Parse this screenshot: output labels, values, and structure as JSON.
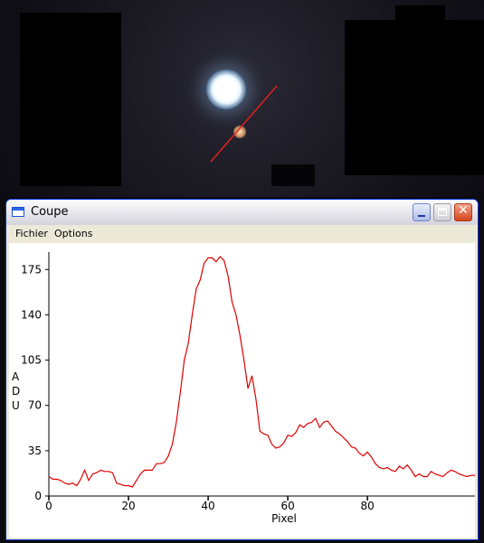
{
  "window": {
    "title": "Coupe",
    "buttons": {
      "minimize_icon": "minimize-icon",
      "maximize_icon": "maximize-icon",
      "close_icon": "close-icon",
      "close_glyph": "✕"
    }
  },
  "menu": {
    "items": [
      {
        "label": "Fichier"
      },
      {
        "label": "Options"
      }
    ]
  },
  "chart_data": {
    "type": "line",
    "xlabel": "Pixel",
    "ylabel": "A\nD\nU",
    "ylabel_letters": [
      "A",
      "D",
      "U"
    ],
    "x_ticks": [
      0,
      20,
      40,
      60,
      80
    ],
    "y_ticks": [
      0,
      35,
      70,
      105,
      140,
      175
    ],
    "xlim": [
      0,
      107
    ],
    "ylim": [
      0,
      185
    ],
    "line_color": "#e00000",
    "series": [
      {
        "x": [
          0,
          1,
          2,
          3,
          4,
          5,
          6,
          7,
          8,
          9,
          10,
          11,
          12,
          13,
          14,
          15,
          16,
          17,
          18,
          19,
          20,
          21,
          22,
          23,
          24,
          25,
          26,
          27,
          28,
          29,
          30,
          31,
          32,
          33,
          34,
          35,
          36,
          37,
          38,
          39,
          40,
          41,
          42,
          43,
          44,
          45,
          46,
          47,
          48,
          49,
          50,
          51,
          52,
          53,
          54,
          55,
          56,
          57,
          58,
          59,
          60,
          61,
          62,
          63,
          64,
          65,
          66,
          67,
          68,
          69,
          70,
          71,
          72,
          73,
          74,
          75,
          76,
          77,
          78,
          79,
          80,
          81,
          82,
          83,
          84,
          85,
          86,
          87,
          88,
          89,
          90,
          91,
          92,
          93,
          94,
          95,
          96,
          97,
          98,
          99,
          100,
          101,
          102,
          103,
          104,
          105,
          106,
          107
        ],
        "y": [
          15,
          13,
          13,
          12,
          10,
          9,
          10,
          8,
          13,
          20,
          12,
          17,
          18,
          20,
          19,
          19,
          18,
          10,
          9,
          8,
          8,
          7,
          12,
          17,
          20,
          20,
          20,
          25,
          25,
          26,
          31,
          40,
          57,
          80,
          105,
          118,
          140,
          160,
          167,
          180,
          184,
          184,
          181,
          185,
          182,
          170,
          150,
          140,
          124,
          105,
          83,
          93,
          75,
          50,
          48,
          47,
          40,
          37,
          38,
          41,
          47,
          46,
          49,
          55,
          53,
          56,
          57,
          60,
          53,
          57,
          58,
          54,
          50,
          48,
          45,
          42,
          38,
          37,
          33,
          31,
          34,
          30,
          25,
          22,
          21,
          22,
          20,
          19,
          23,
          21,
          24,
          20,
          15,
          17,
          15,
          15,
          19,
          17,
          16,
          15,
          18,
          20,
          19,
          17,
          16,
          15,
          16,
          16
        ]
      }
    ]
  },
  "sky": {
    "cut_line_color": "#e02020"
  }
}
